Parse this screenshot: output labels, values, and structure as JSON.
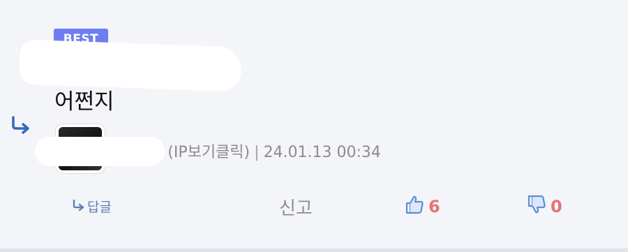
{
  "comment": {
    "badge": "BEST",
    "text": "어쩐지",
    "meta": {
      "author_suffix": "!",
      "ip": "(IP보기클릭)",
      "timestamp": "24.01.13 00:34"
    }
  },
  "actions": {
    "reply_label": "답글",
    "report_label": "신고",
    "like_count": "6",
    "dislike_count": "0"
  },
  "colors": {
    "badge": "#6e7ef0",
    "reply_arrow": "#2f6bbd",
    "like_icon": "#5b8fd0",
    "count": "#e57373"
  },
  "icons": {
    "reply_indicator": "reply-arrow-icon",
    "reply_button": "reply-small-icon",
    "like": "thumbs-up-icon",
    "dislike": "thumbs-down-icon"
  }
}
